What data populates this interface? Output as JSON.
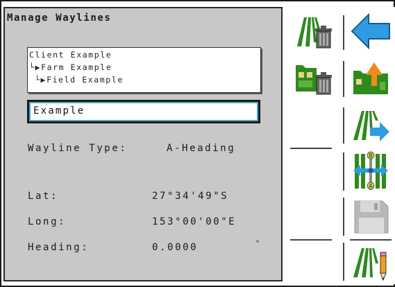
{
  "title": "Manage Waylines",
  "hierarchy": {
    "client": "Client Example",
    "farm": "Farm Example",
    "field": "Field Example"
  },
  "wayline_name": "Example",
  "wayline_type": {
    "label": "Wayline Type:",
    "value": "A-Heading"
  },
  "lat": {
    "label": "Lat:",
    "value": "27°34'49\"S"
  },
  "long": {
    "label": "Long:",
    "value": "153°00'00\"E"
  },
  "heading": {
    "label": "Heading:",
    "value": "0.0000",
    "unit": "°"
  },
  "icons": {
    "delete_wayline": "wayline-delete-icon",
    "back": "back-arrow-icon",
    "delete_field": "field-delete-icon",
    "field_export": "field-export-icon",
    "wayline_send": "wayline-send-icon",
    "ab_shift": "ab-shift-icon",
    "save": "save-icon",
    "edit_wayline": "wayline-edit-icon"
  },
  "colors": {
    "panel_bg": "#c8c8c8",
    "green": "#2f8a1e",
    "blue": "#2f9be0",
    "orange": "#f08a1e"
  }
}
